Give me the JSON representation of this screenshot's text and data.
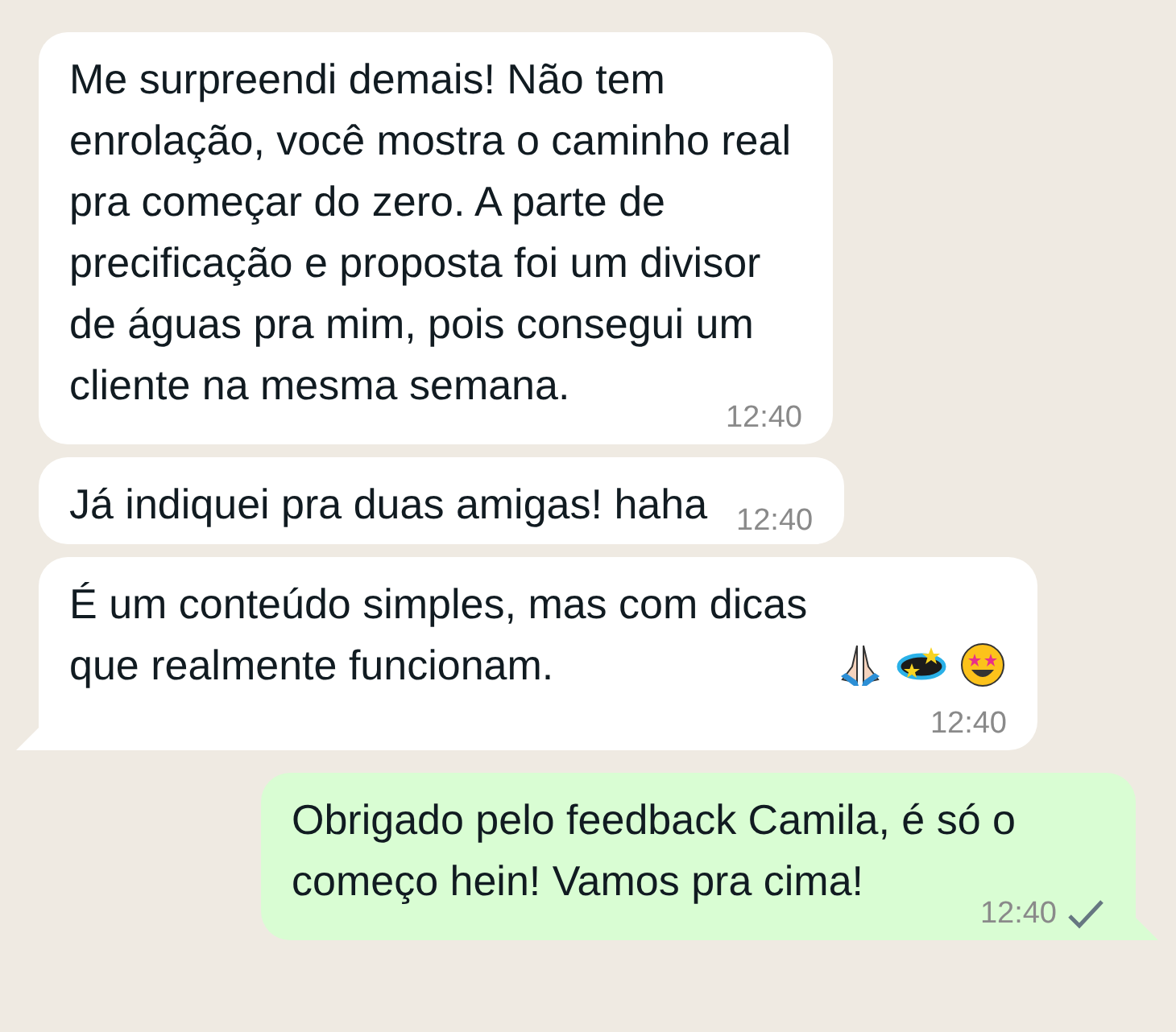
{
  "messages": [
    {
      "outgoing": false,
      "tail": false,
      "time_inline": false,
      "text": "Me surpreendi demais! Não tem enrolação, você mostra o caminho real pra começar do zero. A parte de precificação e proposta foi um divisor de águas pra mim, pois consegui um cliente na mesma semana.",
      "time": "12:40"
    },
    {
      "outgoing": false,
      "tail": false,
      "time_inline": true,
      "text": "Já indiquei pra duas amigas! haha",
      "time": "12:40"
    },
    {
      "outgoing": false,
      "tail": true,
      "time_inline": false,
      "text": "É um conteúdo simples, mas com dicas que realmente funcionam.",
      "emojis": [
        {
          "kind": "praying-hands"
        },
        {
          "kind": "dizzy"
        },
        {
          "kind": "star-struck"
        }
      ],
      "time": "12:40"
    },
    {
      "outgoing": true,
      "tail": true,
      "time_inline": false,
      "text": "Obrigado pelo feedback Camila, é só o começo hein! Vamos pra cima!",
      "time": "12:40",
      "delivered": false
    }
  ]
}
